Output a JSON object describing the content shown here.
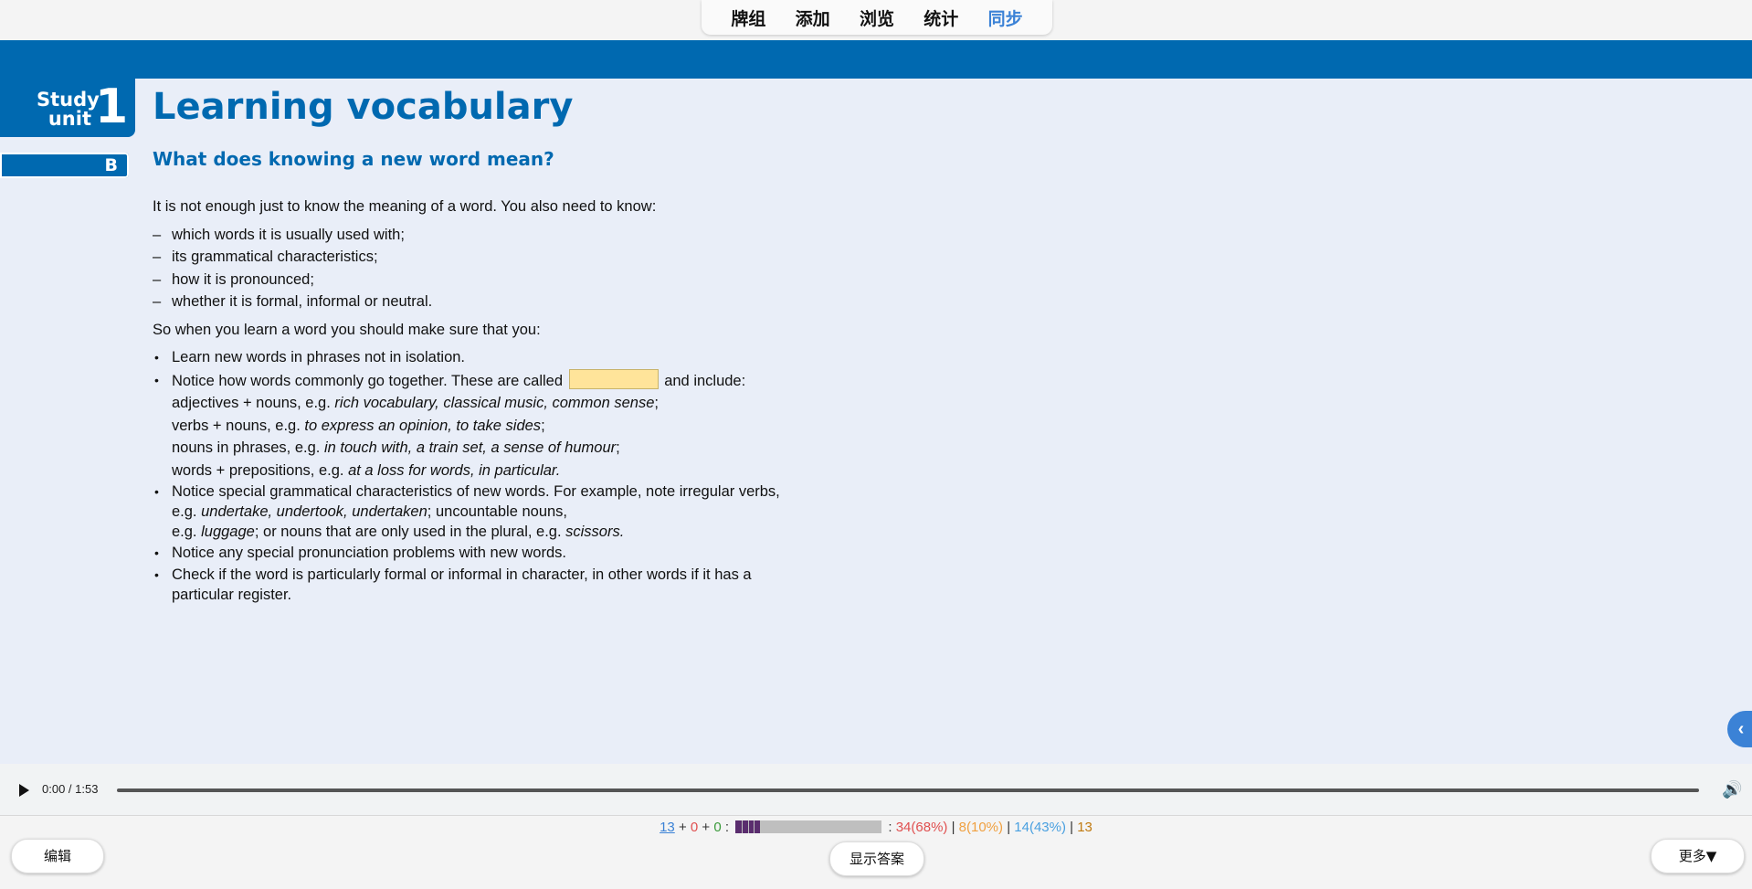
{
  "topnav": {
    "items": [
      "牌组",
      "添加",
      "浏览",
      "统计",
      "同步"
    ],
    "active_index": 4
  },
  "card": {
    "unit_label_line1": "Study",
    "unit_label_line2": "unit",
    "unit_number": "1",
    "section_letter": "B",
    "title": "Learning vocabulary",
    "subtitle": "What does knowing a new word mean?",
    "intro": "It is not enough just to know the meaning of a word. You also need to know:",
    "know_list": [
      "which words it is usually used with;",
      "its grammatical characteristics;",
      "how it is pronounced;",
      "whether it is formal, informal or neutral."
    ],
    "so_text": "So when you learn a word you should make sure that you:",
    "bullet1": "Learn new words in phrases not in isolation.",
    "bullet2_before": "Notice how words commonly go together. These are called",
    "bullet2_after": "and include:",
    "combo_lines": [
      {
        "plain": "adjectives + nouns, e.g. ",
        "italic": "rich vocabulary, classical music, common sense",
        "end": ";"
      },
      {
        "plain": "verbs + nouns, e.g. ",
        "italic": "to express an opinion, to take sides",
        "end": ";"
      },
      {
        "plain": "nouns in phrases, e.g. ",
        "italic": "in touch with, a train set, a sense of humour",
        "end": ";"
      },
      {
        "plain": "words + prepositions, e.g. ",
        "italic": "at a loss for words, in particular.",
        "end": ""
      }
    ],
    "bullet3_line1": "Notice special grammatical characteristics of new words. For example, note irregular verbs,",
    "bullet3_eg1": "e.g. ",
    "bullet3_italic1": "undertake, undertook,  undertaken",
    "bullet3_mid": "; uncountable nouns,",
    "bullet3_eg2": "e.g. ",
    "bullet3_italic2": "luggage",
    "bullet3_mid2": "; or nouns that are only used in the plural, e.g. ",
    "bullet3_italic3": "scissors.",
    "bullet4": "Notice any special pronunciation problems with new words.",
    "bullet5": "Check if the word is particularly formal or informal in character, in other words if it has a particular register.",
    "side_handle_icon": "chevron-left-icon"
  },
  "audio": {
    "time": "0:00 / 1:53",
    "progress": 0
  },
  "stats": {
    "new": "13",
    "plus1": "+",
    "learning": "0",
    "plus2": "+",
    "review": "0",
    "colon": ":",
    "bar_fraction": 0.17,
    "colon2": ":",
    "again": "34(68%)",
    "hard": "8(10%)",
    "good": "14(43%)",
    "total": "13",
    "sep": "|"
  },
  "buttons": {
    "edit": "编辑",
    "show_answer": "显示答案",
    "more": "更多▼"
  },
  "colors": {
    "accent_blue": "#0069b0",
    "active_nav": "#3b82d6",
    "card_bg": "#e9eef8",
    "cloze_highlight": "#ffe49a"
  }
}
